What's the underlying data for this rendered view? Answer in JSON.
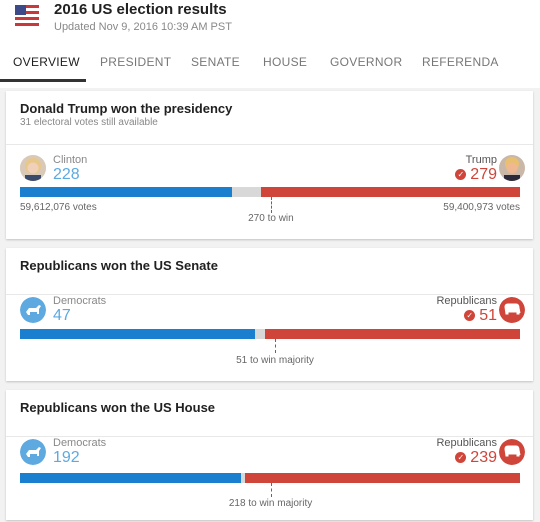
{
  "header": {
    "title": "2016 US election results",
    "updated": "Updated Nov 9, 2016 10:39 AM PST"
  },
  "tabs": [
    {
      "label": "OVERVIEW",
      "active": true
    },
    {
      "label": "PRESIDENT",
      "active": false
    },
    {
      "label": "SENATE",
      "active": false
    },
    {
      "label": "HOUSE",
      "active": false
    },
    {
      "label": "GOVERNOR",
      "active": false
    },
    {
      "label": "REFERENDA",
      "active": false
    }
  ],
  "colors": {
    "dem": "#1a7fcf",
    "rep": "#d0453a",
    "remaining": "#d8d8d8",
    "dem_light": "#5da9e0"
  },
  "president": {
    "title": "Donald Trump won the presidency",
    "subtitle": "31 electoral votes still available",
    "left_name": "Clinton",
    "left_value": "228",
    "left_votes": "59,612,076 votes",
    "right_name": "Trump",
    "right_value": "279",
    "right_votes": "59,400,973 votes",
    "threshold_label": "270 to win",
    "total": 538,
    "dem_seats": 228,
    "rep_seats": 279,
    "threshold": 270
  },
  "senate": {
    "title": "Republicans won the US Senate",
    "left_name": "Democrats",
    "left_value": "47",
    "right_name": "Republicans",
    "right_value": "51",
    "threshold_label": "51 to win majority",
    "total": 100,
    "dem_seats": 47,
    "rep_seats": 51,
    "threshold": 51
  },
  "house": {
    "title": "Republicans won the US House",
    "left_name": "Democrats",
    "left_value": "192",
    "right_name": "Republicans",
    "right_value": "239",
    "threshold_label": "218 to win majority",
    "total": 435,
    "dem_seats": 192,
    "rep_seats": 239,
    "threshold": 218
  }
}
